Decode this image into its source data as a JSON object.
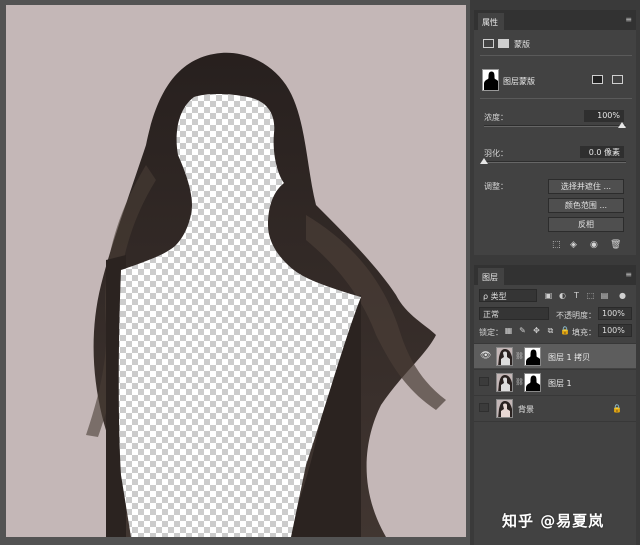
{
  "colors": {
    "canvas_bg": "#c4b7b7",
    "hair": "#2a2220",
    "panel": "#424242",
    "panel_header": "#323232",
    "checker_light": "#ffffff",
    "checker_dark": "#cccccc"
  },
  "properties": {
    "tab_label": "属性",
    "mask_tab_label": "蒙版",
    "mask_name": "图层蒙版",
    "density_label": "浓度：",
    "density_value": "100%",
    "density_level": 1.0,
    "feather_label": "羽化：",
    "feather_value": "0.0 像素",
    "feather_level": 0.0,
    "adjust_label": "调整：",
    "buttons": [
      "选择并遮住 ...",
      "颜色范围 ...",
      "反相"
    ],
    "footer_icons": [
      "selection-icon",
      "apply-mask-icon",
      "visibility-icon",
      "trash-icon"
    ]
  },
  "layers": {
    "tab_label": "图层",
    "filter_label": "ρ 类型",
    "blend_mode": "正常",
    "opacity_label": "不透明度：",
    "opacity_value": "100%",
    "lock_label": "锁定：",
    "fill_label": "填充：",
    "fill_value": "100%",
    "items": [
      {
        "name": "图层 1 拷贝",
        "visible": true,
        "selected": true,
        "has_mask": true
      },
      {
        "name": "图层 1",
        "visible": false,
        "selected": false,
        "has_mask": true
      },
      {
        "name": "背景",
        "visible": false,
        "selected": false,
        "has_mask": false,
        "locked": true
      }
    ]
  },
  "watermark": "知乎 @易夏岚"
}
